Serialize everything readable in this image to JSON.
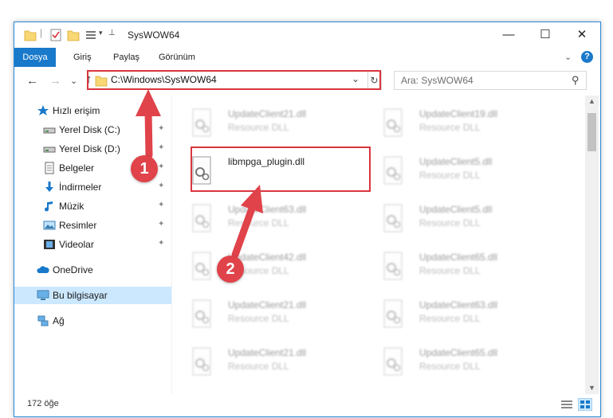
{
  "window": {
    "title": "SysWOW64",
    "controls": {
      "minimize": "—",
      "maximize": "☐",
      "close": "✕"
    }
  },
  "ribbon": {
    "tabs": [
      "Dosya",
      "Giriş",
      "Paylaş",
      "Görünüm"
    ],
    "expand": "⌄",
    "help": "?"
  },
  "address": {
    "path": "C:\\Windows\\SysWOW64",
    "search_placeholder": "Ara: SysWOW64",
    "back": "←",
    "forward": "→",
    "recent": "⌄",
    "up": "↑",
    "dropdown": "⌄",
    "refresh": "↻",
    "search_icon": "⚲"
  },
  "sidebar": {
    "items": [
      {
        "label": "Hızlı erişim",
        "icon": "star-icon",
        "pinned": false
      },
      {
        "label": "Yerel Disk (C:)",
        "icon": "drive-icon",
        "pinned": true
      },
      {
        "label": "Yerel Disk (D:)",
        "icon": "drive-icon",
        "pinned": true
      },
      {
        "label": "Belgeler",
        "icon": "document-icon",
        "pinned": true
      },
      {
        "label": "İndirmeler",
        "icon": "download-icon",
        "pinned": true
      },
      {
        "label": "Müzik",
        "icon": "music-icon",
        "pinned": true
      },
      {
        "label": "Resimler",
        "icon": "pictures-icon",
        "pinned": true
      },
      {
        "label": "Videolar",
        "icon": "video-icon",
        "pinned": true
      },
      {
        "label": "OneDrive",
        "icon": "cloud-icon",
        "pinned": false
      },
      {
        "label": "Bu bilgisayar",
        "icon": "computer-icon",
        "pinned": false,
        "selected": true
      },
      {
        "label": "Ağ",
        "icon": "network-icon",
        "pinned": false
      }
    ],
    "pin_glyph": "✦"
  },
  "files": {
    "left": [
      {
        "name": "UpdateClient21.dll",
        "type": "Resource DLL",
        "blurred": true
      },
      {
        "name": "libmpga_plugin.dll",
        "type": "",
        "blurred": false
      },
      {
        "name": "UpdateClient63.dll",
        "type": "Resource DLL",
        "blurred": true
      },
      {
        "name": "UpdateClient42.dll",
        "type": "Resource DLL",
        "blurred": true
      },
      {
        "name": "UpdateClient21.dll",
        "type": "Resource DLL",
        "blurred": true
      },
      {
        "name": "UpdateClient21.dll",
        "type": "Resource DLL",
        "blurred": true
      }
    ],
    "right": [
      {
        "name": "UpdateClient19.dll",
        "type": "Resource DLL",
        "blurred": true
      },
      {
        "name": "UpdateClient5.dll",
        "type": "Resource DLL",
        "blurred": true
      },
      {
        "name": "UpdateClient5.dll",
        "type": "Resource DLL",
        "blurred": true
      },
      {
        "name": "UpdateClient65.dll",
        "type": "Resource DLL",
        "blurred": true
      },
      {
        "name": "UpdateClient63.dll",
        "type": "Resource DLL",
        "blurred": true
      },
      {
        "name": "UpdateClient65.dll",
        "type": "Resource DLL",
        "blurred": true
      }
    ]
  },
  "status": {
    "count": "172 öğe"
  },
  "annotations": {
    "step1": "1",
    "step2": "2"
  },
  "colors": {
    "accent": "#1979ca",
    "highlight": "#d9363e",
    "selected": "#cce8ff"
  }
}
